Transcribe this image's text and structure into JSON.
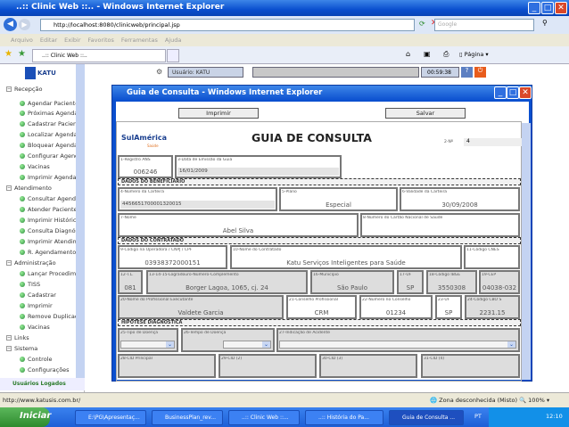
{
  "browser": {
    "title": "..:: Clinic Web ::.. - Windows Internet Explorer",
    "url": "http://localhost:8080/clinicweb/principal.jsp",
    "search_placeholder": "Google",
    "menu": [
      "Arquivo",
      "Editar",
      "Exibir",
      "Favoritos",
      "Ferramentas",
      "Ajuda"
    ],
    "tab": "..:: Clinic Web ::..",
    "page_menu": "Página"
  },
  "app": {
    "logo": "KATU",
    "user": "Usuário: KATU",
    "time": "00:59:38"
  },
  "sidebar": {
    "items": [
      {
        "label": "Recepção",
        "type": "group"
      },
      {
        "label": "Agendar Paciente"
      },
      {
        "label": "Próximas Agendas"
      },
      {
        "label": "Cadastrar Paciente"
      },
      {
        "label": "Localizar Agenda"
      },
      {
        "label": "Bloquear Agenda"
      },
      {
        "label": "Configurar Agenda"
      },
      {
        "label": "Vacinas"
      },
      {
        "label": "Imprimir Agenda"
      },
      {
        "label": "Atendimento",
        "type": "group"
      },
      {
        "label": "Consultar Agenda"
      },
      {
        "label": "Atender Paciente"
      },
      {
        "label": "Imprimir Histórico"
      },
      {
        "label": "Consulta Diagnóstico"
      },
      {
        "label": "Imprimir Atendimento"
      },
      {
        "label": "R. Agendamento"
      },
      {
        "label": "Administração",
        "type": "group"
      },
      {
        "label": "Lançar Procedimento"
      },
      {
        "label": "TISS"
      },
      {
        "label": "Cadastrar"
      },
      {
        "label": "Imprimir"
      },
      {
        "label": "Remove Duplicados"
      },
      {
        "label": "Vacinas"
      },
      {
        "label": "Links",
        "type": "group"
      },
      {
        "label": "Sistema",
        "type": "group"
      },
      {
        "label": "Controle"
      },
      {
        "label": "Configurações"
      }
    ],
    "footer": "Usuários Logados"
  },
  "popup": {
    "title": "Guia de Consulta - Windows Internet Explorer",
    "print": "Imprimir",
    "save": "Salvar"
  },
  "form": {
    "brand": "SulAmérica",
    "brand_sub": "Saúde",
    "title": "GUIA DE CONSULTA",
    "guide_no_label": "2-Nº",
    "guide_no": "4",
    "sections": [
      "DADOS DO BENEFICIÁRIO",
      "DADOS DO CONTRATADO",
      "HIPÓTESE DIAGNÓSTICA"
    ],
    "fields": {
      "f1": {
        "label": "1-Registro ANS",
        "value": "006246"
      },
      "f3": {
        "label": "3-Data de Emissão da Guia",
        "value": "16/01/2009"
      },
      "f4": {
        "label": "4-Número da Carteira",
        "value": "4456651700001320015"
      },
      "f5": {
        "label": "5-Plano",
        "value": "Especial"
      },
      "f6": {
        "label": "6-Validade da Carteira",
        "value": "30/09/2008"
      },
      "f7": {
        "label": "7-Nome",
        "value": "Abel Silva"
      },
      "f8": {
        "label": "8-Número do Cartão Nacional de Saúde",
        "value": ""
      },
      "f9": {
        "label": "9-Código na Operadora / CNPJ / CPF",
        "value": "03938372000151"
      },
      "f10": {
        "label": "10-Nome do Contratado",
        "value": "Katu Serviços Inteligentes para Saúde"
      },
      "f11": {
        "label": "11-Código CNES",
        "value": ""
      },
      "f12": {
        "label": "12-T.L.",
        "value": "081"
      },
      "f13": {
        "label": "13-14-15-Logradouro-Número-Complemento",
        "value": "Borger Lagoa, 1065, cj. 24"
      },
      "f16": {
        "label": "16-Município",
        "value": "São Paulo"
      },
      "f17": {
        "label": "17-UF",
        "value": "SP"
      },
      "f18": {
        "label": "18-Código IBGE",
        "value": "3550308"
      },
      "f19": {
        "label": "19-CEP",
        "value": "04038-032"
      },
      "f20": {
        "label": "20-Nome do Profissional Executante",
        "value": "Valdete Garcia"
      },
      "f21": {
        "label": "21-Conselho Profissional",
        "value": "CRM"
      },
      "f22": {
        "label": "22-Número no Conselho",
        "value": "01234"
      },
      "f23": {
        "label": "23-UF",
        "value": "SP"
      },
      "f24": {
        "label": "24-Código CBO S",
        "value": "2231.15"
      },
      "f25": {
        "label": "25-Tipo de Doença"
      },
      "f26": {
        "label": "26-Tempo de Doença"
      },
      "f27": {
        "label": "27-Indicação de Acidente"
      },
      "f28": {
        "label": "28-CID Principal"
      },
      "f29": {
        "label": "29-CID (2)"
      },
      "f30": {
        "label": "30-CID (3)"
      },
      "f31": {
        "label": "31-CID (4)"
      }
    }
  },
  "status": {
    "url": "http://www.katusis.com.br/",
    "zone": "Zona desconhecida (Misto)",
    "zoom": "100%"
  },
  "taskbar": {
    "start": "Iniciar",
    "tasks": [
      "E:\\PG\\Apresentaç...",
      "BusinessPlan_rev...",
      "..:: Clinic Web ::...",
      "..:: História do Pa...",
      "Guia de Consulta ..."
    ],
    "lang": "PT",
    "clock": "12:10"
  }
}
